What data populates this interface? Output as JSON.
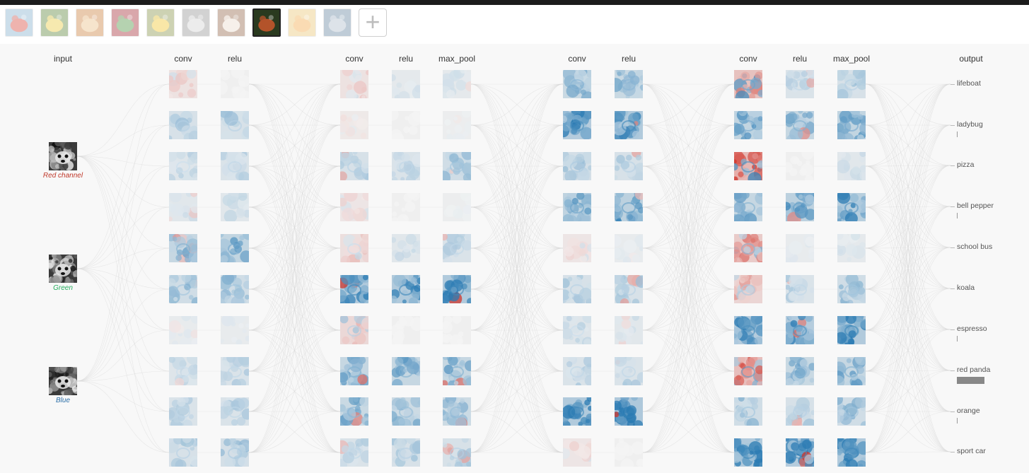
{
  "thumbnails": [
    {
      "name": "lifeboat",
      "bg": "#7aa9c9",
      "fg": "#d33a2c",
      "selected": false
    },
    {
      "name": "ladybug",
      "bg": "#4f7a2a",
      "fg": "#e8c830",
      "selected": false
    },
    {
      "name": "pizza",
      "bg": "#c8752d",
      "fg": "#e9b97a",
      "selected": false
    },
    {
      "name": "bell pepper",
      "bg": "#9e1b24",
      "fg": "#3f8a33",
      "selected": false
    },
    {
      "name": "school bus",
      "bg": "#7d8a3a",
      "fg": "#f0c21a",
      "selected": false
    },
    {
      "name": "koala",
      "bg": "#8c8c8c",
      "fg": "#cfcfcf",
      "selected": false
    },
    {
      "name": "espresso",
      "bg": "#8a5a3a",
      "fg": "#e9d9c9",
      "selected": false
    },
    {
      "name": "red panda",
      "bg": "#2a3a1f",
      "fg": "#b3532a",
      "selected": true
    },
    {
      "name": "orange",
      "bg": "#e8c26a",
      "fg": "#f2a23a",
      "selected": false
    },
    {
      "name": "sport car",
      "bg": "#5a7b98",
      "fg": "#a8b8c8",
      "selected": false
    }
  ],
  "add_button_label": "+",
  "layers": [
    {
      "label": "input",
      "kind": "input"
    },
    {
      "label": "conv",
      "kind": "conv"
    },
    {
      "label": "relu",
      "kind": "relu"
    },
    {
      "label": "conv",
      "kind": "conv"
    },
    {
      "label": "relu",
      "kind": "relu"
    },
    {
      "label": "max_pool",
      "kind": "pool"
    },
    {
      "label": "conv",
      "kind": "conv"
    },
    {
      "label": "relu",
      "kind": "relu"
    },
    {
      "label": "conv",
      "kind": "conv"
    },
    {
      "label": "relu",
      "kind": "relu"
    },
    {
      "label": "max_pool",
      "kind": "pool"
    },
    {
      "label": "output",
      "kind": "output"
    }
  ],
  "input_channels": [
    {
      "label": "Red channel",
      "color": "#c0392b"
    },
    {
      "label": "Green",
      "color": "#27ae60"
    },
    {
      "label": "Blue",
      "color": "#2c6fa8"
    }
  ],
  "activation_strengths": [
    [
      0.2,
      0.35,
      0.25,
      0.2,
      0.6,
      0.45,
      0.1,
      0.25,
      0.3,
      0.35
    ],
    [
      0.0,
      0.35,
      0.3,
      0.2,
      0.65,
      0.45,
      0.1,
      0.3,
      0.3,
      0.4
    ],
    [
      0.2,
      0.1,
      0.35,
      0.15,
      0.25,
      0.9,
      0.35,
      0.6,
      0.55,
      0.3
    ],
    [
      0.15,
      0.0,
      0.3,
      0.0,
      0.2,
      0.9,
      0.0,
      0.6,
      0.5,
      0.35
    ],
    [
      0.15,
      0.05,
      0.45,
      0.05,
      0.3,
      0.9,
      0.0,
      0.6,
      0.5,
      0.35
    ],
    [
      0.55,
      0.85,
      0.4,
      0.7,
      0.15,
      0.35,
      0.25,
      0.3,
      0.9,
      0.15
    ],
    [
      0.55,
      0.9,
      0.35,
      0.75,
      0.1,
      0.35,
      0.2,
      0.3,
      0.95,
      0.0
    ],
    [
      0.7,
      0.65,
      0.85,
      0.6,
      0.55,
      0.4,
      0.85,
      0.75,
      0.45,
      0.9
    ],
    [
      0.3,
      0.6,
      0.0,
      0.75,
      0.1,
      0.3,
      0.85,
      0.55,
      0.35,
      0.85
    ],
    [
      0.35,
      0.65,
      0.2,
      0.8,
      0.15,
      0.45,
      0.9,
      0.6,
      0.45,
      0.9
    ]
  ],
  "activation_signs": [
    [
      -1,
      1,
      1,
      1,
      1,
      1,
      1,
      1,
      1,
      1
    ],
    [
      1,
      1,
      1,
      1,
      1,
      1,
      1,
      1,
      1,
      1
    ],
    [
      -1,
      -1,
      1,
      -1,
      -1,
      1,
      -1,
      1,
      1,
      1
    ],
    [
      1,
      1,
      1,
      1,
      1,
      1,
      1,
      1,
      1,
      1
    ],
    [
      1,
      1,
      1,
      1,
      1,
      1,
      1,
      1,
      1,
      1
    ],
    [
      1,
      1,
      1,
      1,
      -1,
      1,
      1,
      1,
      1,
      -1
    ],
    [
      1,
      1,
      1,
      1,
      1,
      1,
      1,
      1,
      1,
      1
    ],
    [
      -1,
      1,
      -1,
      1,
      -1,
      -1,
      1,
      -1,
      1,
      1
    ],
    [
      1,
      1,
      1,
      1,
      1,
      1,
      1,
      1,
      1,
      1
    ],
    [
      1,
      1,
      1,
      1,
      1,
      1,
      1,
      1,
      1,
      1
    ]
  ],
  "output_classes": [
    {
      "label": "lifeboat",
      "prob": 0.0
    },
    {
      "label": "ladybug",
      "prob": 0.02
    },
    {
      "label": "pizza",
      "prob": 0.0
    },
    {
      "label": "bell pepper",
      "prob": 0.01
    },
    {
      "label": "school bus",
      "prob": 0.0
    },
    {
      "label": "koala",
      "prob": 0.0
    },
    {
      "label": "espresso",
      "prob": 0.01
    },
    {
      "label": "red panda",
      "prob": 0.94
    },
    {
      "label": "orange",
      "prob": 0.01
    },
    {
      "label": "sport car",
      "prob": 0.0
    }
  ],
  "colors": {
    "positive": "#2b7bb3",
    "negative": "#d0362c",
    "edge": "#d9d9d9",
    "bar": "#888888"
  }
}
